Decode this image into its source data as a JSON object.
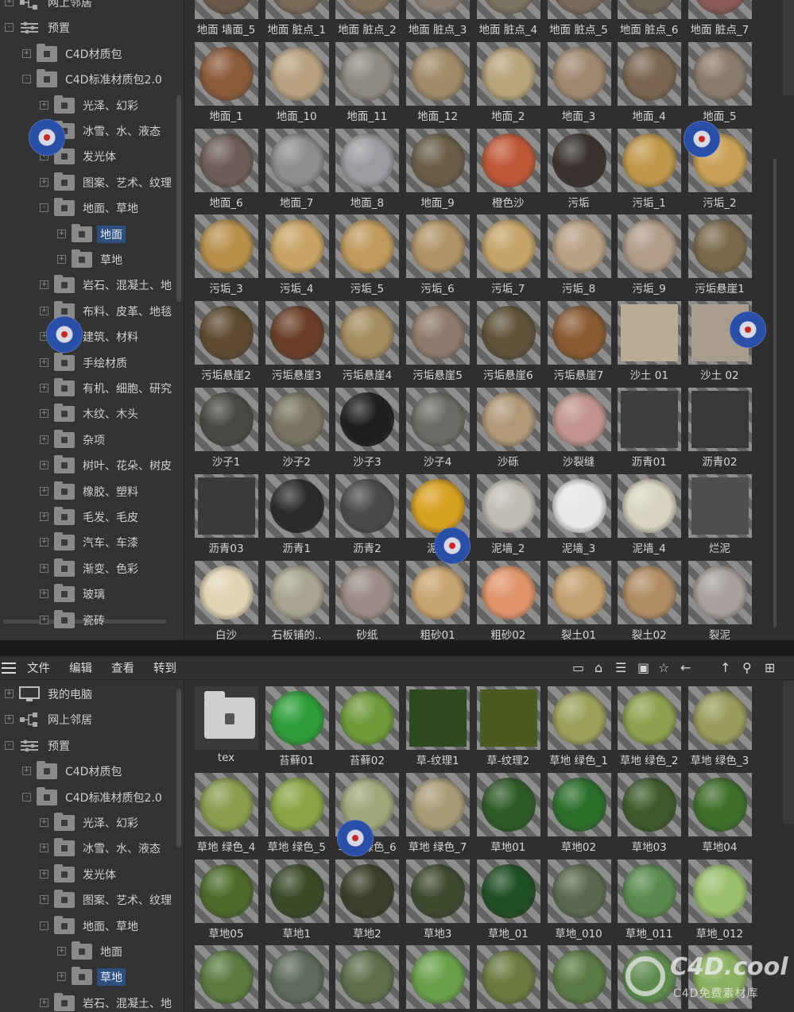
{
  "top_tree": [
    {
      "label": "网上邻居",
      "indent": 0,
      "icon": "network",
      "exp": "+"
    },
    {
      "label": "预置",
      "indent": 0,
      "icon": "settings",
      "exp": "-"
    },
    {
      "label": "C4D材质包",
      "indent": 1,
      "icon": "folder",
      "exp": "+"
    },
    {
      "label": "C4D标准材质包2.0",
      "indent": 1,
      "icon": "folder-open",
      "exp": "-"
    },
    {
      "label": "光泽、幻彩",
      "indent": 2,
      "icon": "folder",
      "exp": "+"
    },
    {
      "label": "冰雪、水、液态",
      "indent": 2,
      "icon": "folder",
      "exp": "+"
    },
    {
      "label": "发光体",
      "indent": 2,
      "icon": "folder",
      "exp": "+"
    },
    {
      "label": "图案、艺术、纹理",
      "indent": 2,
      "icon": "folder",
      "exp": "+"
    },
    {
      "label": "地面、草地",
      "indent": 2,
      "icon": "folder-open",
      "exp": "-"
    },
    {
      "label": "地面",
      "indent": 3,
      "icon": "folder",
      "exp": "+",
      "selected": true
    },
    {
      "label": "草地",
      "indent": 3,
      "icon": "folder",
      "exp": "+"
    },
    {
      "label": "岩石、混凝土、地",
      "indent": 2,
      "icon": "folder",
      "exp": "+"
    },
    {
      "label": "布料、皮革、地毯",
      "indent": 2,
      "icon": "folder",
      "exp": "+"
    },
    {
      "label": "建筑、材料",
      "indent": 2,
      "icon": "folder",
      "exp": "+"
    },
    {
      "label": "手绘材质",
      "indent": 2,
      "icon": "folder",
      "exp": "+"
    },
    {
      "label": "有机、细胞、研究",
      "indent": 2,
      "icon": "folder",
      "exp": "+"
    },
    {
      "label": "木纹、木头",
      "indent": 2,
      "icon": "folder",
      "exp": "+"
    },
    {
      "label": "杂项",
      "indent": 2,
      "icon": "folder",
      "exp": "+"
    },
    {
      "label": "树叶、花朵、树皮",
      "indent": 2,
      "icon": "folder",
      "exp": "+"
    },
    {
      "label": "橡胶、塑料",
      "indent": 2,
      "icon": "folder",
      "exp": "+"
    },
    {
      "label": "毛发、毛皮",
      "indent": 2,
      "icon": "folder",
      "exp": "+"
    },
    {
      "label": "汽车、车漆",
      "indent": 2,
      "icon": "folder",
      "exp": "+"
    },
    {
      "label": "渐变、色彩",
      "indent": 2,
      "icon": "folder",
      "exp": "+"
    },
    {
      "label": "玻璃",
      "indent": 2,
      "icon": "folder",
      "exp": "+"
    },
    {
      "label": "瓷砖",
      "indent": 2,
      "icon": "folder",
      "exp": "+"
    }
  ],
  "top_materials": [
    [
      {
        "n": "地面 墙面_5",
        "c": "#6b5a4a"
      },
      {
        "n": "地面 脏点_1",
        "c": "#7a6a58"
      },
      {
        "n": "地面 脏点_2",
        "c": "#80735f"
      },
      {
        "n": "地面 脏点_3",
        "c": "#8a7e74"
      },
      {
        "n": "地面 脏点_4",
        "c": "#7c7462"
      },
      {
        "n": "地面 脏点_5",
        "c": "#7a6a5a"
      },
      {
        "n": "地面 脏点_6",
        "c": "#6f6558"
      },
      {
        "n": "地面 脏点_7",
        "c": "#8a5a58"
      }
    ],
    [
      {
        "n": "地面_1",
        "c": "#8a5a3a"
      },
      {
        "n": "地面_10",
        "c": "#b8a080"
      },
      {
        "n": "地面_11",
        "c": "#8e8a82"
      },
      {
        "n": "地面_12",
        "c": "#a08a68"
      },
      {
        "n": "地面_2",
        "c": "#b8a47c"
      },
      {
        "n": "地面_3",
        "c": "#a08870"
      },
      {
        "n": "地面_4",
        "c": "#7a6650"
      },
      {
        "n": "地面_5",
        "c": "#8a7a6c"
      }
    ],
    [
      {
        "n": "地面_6",
        "c": "#6e5e58"
      },
      {
        "n": "地面_7",
        "c": "#8e8e8e"
      },
      {
        "n": "地面_8",
        "c": "#9c9ca0"
      },
      {
        "n": "地面_9",
        "c": "#6a5e48"
      },
      {
        "n": "橙色沙",
        "c": "#c05838"
      },
      {
        "n": "污垢",
        "c": "#3a3230"
      },
      {
        "n": "污垢_1",
        "c": "#c0984c"
      },
      {
        "n": "污垢_2",
        "c": "#c8a058"
      }
    ],
    [
      {
        "n": "污垢_3",
        "c": "#b8904c"
      },
      {
        "n": "污垢_4",
        "c": "#c8a464"
      },
      {
        "n": "污垢_5",
        "c": "#c09a5c"
      },
      {
        "n": "污垢_6",
        "c": "#b09468"
      },
      {
        "n": "污垢_7",
        "c": "#c4a468"
      },
      {
        "n": "污垢_8",
        "c": "#b8a084"
      },
      {
        "n": "污垢_9",
        "c": "#b09c88"
      },
      {
        "n": "污垢悬崖1",
        "c": "#7a6a4c"
      }
    ],
    [
      {
        "n": "污垢悬崖2",
        "c": "#5e4a30"
      },
      {
        "n": "污垢悬崖3",
        "c": "#6a3e28"
      },
      {
        "n": "污垢悬崖4",
        "c": "#a48c60"
      },
      {
        "n": "污垢悬崖5",
        "c": "#8e7a6a"
      },
      {
        "n": "污垢悬崖6",
        "c": "#5e5238"
      },
      {
        "n": "污垢悬崖7",
        "c": "#8a5a32"
      },
      {
        "n": "沙土 01",
        "c": "#b8ac98",
        "sq": true
      },
      {
        "n": "沙土 02",
        "c": "#a89c8c",
        "sq": true
      }
    ],
    [
      {
        "n": "沙子1",
        "c": "#4a4a44"
      },
      {
        "n": "沙子2",
        "c": "#7a7462"
      },
      {
        "n": "沙子3",
        "c": "#1e1e20"
      },
      {
        "n": "沙子4",
        "c": "#6a6a66"
      },
      {
        "n": "沙砾",
        "c": "#b09878"
      },
      {
        "n": "沙裂缝",
        "c": "#c0948c"
      },
      {
        "n": "沥青01",
        "c": "#3e3e40",
        "sq": true
      },
      {
        "n": "沥青02",
        "c": "#38383a",
        "sq": true
      }
    ],
    [
      {
        "n": "沥青03",
        "c": "#3a3a3c",
        "sq": true
      },
      {
        "n": "沥青1",
        "c": "#2a2a2c"
      },
      {
        "n": "沥青2",
        "c": "#4a4a4c"
      },
      {
        "n": "泥地",
        "c": "#d8a020"
      },
      {
        "n": "泥墙_2",
        "c": "#c0bcb4"
      },
      {
        "n": "泥墙_3",
        "c": "#e8e8ea"
      },
      {
        "n": "泥墙_4",
        "c": "#d8d4c0"
      },
      {
        "n": "烂泥",
        "c": "#4e4e50",
        "sq": true
      }
    ],
    [
      {
        "n": "白沙",
        "c": "#e0d4b4"
      },
      {
        "n": "石板铺的..",
        "c": "#a8a490"
      },
      {
        "n": "砂纸",
        "c": "#9a8c84"
      },
      {
        "n": "粗砂01",
        "c": "#c8a470"
      },
      {
        "n": "粗砂02",
        "c": "#e0946a"
      },
      {
        "n": "裂土01",
        "c": "#c4a070"
      },
      {
        "n": "裂土02",
        "c": "#b08c64"
      },
      {
        "n": "裂泥",
        "c": "#a8a09c"
      }
    ]
  ],
  "menu": {
    "file": "文件",
    "edit": "编辑",
    "view": "查看",
    "goto": "转到"
  },
  "toolbar_icons": [
    "minimize-icon",
    "home-icon",
    "filter-icon",
    "box-icon",
    "star-icon",
    "back-icon",
    "up-icon",
    "search-icon",
    "new-icon"
  ],
  "bottom_tree": [
    {
      "label": "我的电脑",
      "indent": 0,
      "icon": "computer",
      "exp": "+"
    },
    {
      "label": "网上邻居",
      "indent": 0,
      "icon": "network",
      "exp": "+"
    },
    {
      "label": "预置",
      "indent": 0,
      "icon": "settings",
      "exp": "-"
    },
    {
      "label": "C4D材质包",
      "indent": 1,
      "icon": "folder",
      "exp": "+"
    },
    {
      "label": "C4D标准材质包2.0",
      "indent": 1,
      "icon": "folder-open",
      "exp": "-"
    },
    {
      "label": "光泽、幻彩",
      "indent": 2,
      "icon": "folder",
      "exp": "+"
    },
    {
      "label": "冰雪、水、液态",
      "indent": 2,
      "icon": "folder",
      "exp": "+"
    },
    {
      "label": "发光体",
      "indent": 2,
      "icon": "folder",
      "exp": "+"
    },
    {
      "label": "图案、艺术、纹理",
      "indent": 2,
      "icon": "folder",
      "exp": "+"
    },
    {
      "label": "地面、草地",
      "indent": 2,
      "icon": "folder-open",
      "exp": "-"
    },
    {
      "label": "地面",
      "indent": 3,
      "icon": "folder",
      "exp": "+"
    },
    {
      "label": "草地",
      "indent": 3,
      "icon": "folder",
      "exp": "+",
      "selected": true
    },
    {
      "label": "岩石、混凝土、地",
      "indent": 2,
      "icon": "folder",
      "exp": "+"
    }
  ],
  "bottom_materials": [
    [
      {
        "n": "tex",
        "folder": true
      },
      {
        "n": "苔藓01",
        "c": "#2e9e3a"
      },
      {
        "n": "苔藓02",
        "c": "#6e9a3a"
      },
      {
        "n": "草-纹理1",
        "c": "#2c4a1e",
        "sq": true
      },
      {
        "n": "草-纹理2",
        "c": "#4a5a22",
        "sq": true
      },
      {
        "n": "草地 绿色_1",
        "c": "#9ca05a"
      },
      {
        "n": "草地 绿色_2",
        "c": "#8ea04e"
      },
      {
        "n": "草地 绿色_3",
        "c": "#9a9c5c"
      }
    ],
    [
      {
        "n": "草地 绿色_4",
        "c": "#8a9c4e"
      },
      {
        "n": "草地 绿色_5",
        "c": "#8aa446"
      },
      {
        "n": "草地 绿色_6",
        "c": "#a0a67a"
      },
      {
        "n": "草地 绿色_7",
        "c": "#a89c78"
      },
      {
        "n": "草地01",
        "c": "#2e5a26"
      },
      {
        "n": "草地02",
        "c": "#2a6e2a"
      },
      {
        "n": "草地03",
        "c": "#3e5a2a"
      },
      {
        "n": "草地04",
        "c": "#3e6e2a"
      }
    ],
    [
      {
        "n": "草地05",
        "c": "#4e6a2a"
      },
      {
        "n": "草地1",
        "c": "#3a4a26"
      },
      {
        "n": "草地2",
        "c": "#3a3e2a"
      },
      {
        "n": "草地3",
        "c": "#3e4a2e"
      },
      {
        "n": "草地_01",
        "c": "#1e4e22"
      },
      {
        "n": "草地_010",
        "c": "#5a6a4e"
      },
      {
        "n": "草地_011",
        "c": "#5a8a4e"
      },
      {
        "n": "草地_012",
        "c": "#9ac06e"
      }
    ],
    [
      {
        "n": "",
        "c": "#5a7a40"
      },
      {
        "n": "",
        "c": "#5e6a5a"
      },
      {
        "n": "",
        "c": "#5e6e4a"
      },
      {
        "n": "",
        "c": "#6aa04a"
      },
      {
        "n": "",
        "c": "#6a7a40"
      },
      {
        "n": "",
        "c": "#5a7a44"
      },
      {
        "n": "",
        "c": "#5e8a4e"
      },
      {
        "n": "",
        "c": "#8ab060"
      }
    ]
  ],
  "watermark": {
    "brand": "C4D.cool",
    "sub": "C4D免费素材库"
  }
}
